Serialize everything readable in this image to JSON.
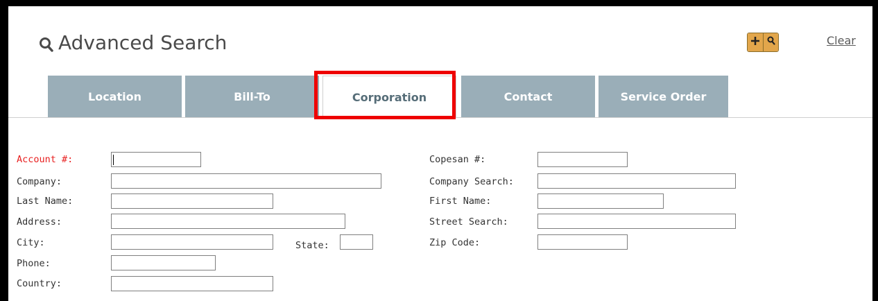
{
  "header": {
    "title": "Advanced Search",
    "add_icon": "plus-icon",
    "search_icon": "search-icon",
    "clear_label": "Clear",
    "accent_color": "#e2a64b"
  },
  "tabs": [
    {
      "label": "Location",
      "active": false
    },
    {
      "label": "Bill-To",
      "active": false
    },
    {
      "label": "Corporation",
      "active": true
    },
    {
      "label": "Contact",
      "active": false
    },
    {
      "label": "Service Order",
      "active": false
    }
  ],
  "highlight_color": "#ee0000",
  "form": {
    "left": [
      {
        "label": "Account #:",
        "value": "",
        "required": true
      },
      {
        "label": "Company:",
        "value": ""
      },
      {
        "label": "Last Name:",
        "value": ""
      },
      {
        "label": "Address:",
        "value": ""
      },
      {
        "label": "City:",
        "value": ""
      },
      {
        "label": "Phone:",
        "value": ""
      },
      {
        "label": "Country:",
        "value": ""
      }
    ],
    "state": {
      "label": "State:",
      "value": ""
    },
    "right": [
      {
        "label": "Copesan #:",
        "value": ""
      },
      {
        "label": "Company Search:",
        "value": ""
      },
      {
        "label": "First Name:",
        "value": ""
      },
      {
        "label": "Street Search:",
        "value": ""
      },
      {
        "label": "Zip Code:",
        "value": ""
      }
    ]
  }
}
